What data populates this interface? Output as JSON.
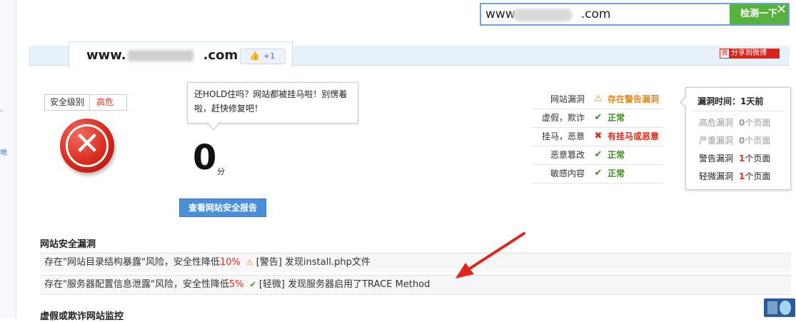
{
  "search": {
    "value_prefix": "www",
    "value_suffix": ".com",
    "button_label": "检测一下",
    "close": "✕"
  },
  "tab": {
    "domain_prefix": "www.",
    "domain_suffix": ".com",
    "like_count": "+1",
    "share_weibo": "分享到微博"
  },
  "security": {
    "level_label": "安全级别",
    "level_value": "高危",
    "score": "0",
    "score_unit": "分",
    "report_button": "查看网站安全报告"
  },
  "bubble": {
    "text": "还HOLD住吗？网站都被挂马啦！别愣着啦，赶快修复吧！"
  },
  "status": [
    {
      "key": "网站漏洞",
      "icon": "warning-icon",
      "value": "存在警告漏洞",
      "tone": "warn"
    },
    {
      "key": "虚假，欺诈",
      "icon": "check-icon",
      "value": "正常",
      "tone": "ok"
    },
    {
      "key": "挂马，恶意",
      "icon": "cross-icon",
      "value": "有挂马或恶意",
      "tone": "bad"
    },
    {
      "key": "恶意篡改",
      "icon": "check-icon",
      "value": "正常",
      "tone": "ok"
    },
    {
      "key": "敏感内容",
      "icon": "check-icon",
      "value": "正常",
      "tone": "ok"
    }
  ],
  "vuln_panel": {
    "head": "漏洞时间：1天前",
    "rows": [
      {
        "label": "高危漏洞",
        "count": "0",
        "unit": "个页面",
        "active": false
      },
      {
        "label": "严重漏洞",
        "count": "0",
        "unit": "个页面",
        "active": false
      },
      {
        "label": "警告漏洞",
        "count": "1",
        "unit": "个页面",
        "active": true
      },
      {
        "label": "轻微漏洞",
        "count": "1",
        "unit": "个页面",
        "active": true
      }
    ]
  },
  "vulns": {
    "title": "网站安全漏洞",
    "items": [
      {
        "pre": "存在\"网站目录结构暴露\"风险，安全性降低",
        "pct": "10%",
        "level": "[警告]",
        "desc": "发现install.php文件",
        "icon": "warning-icon"
      },
      {
        "pre": "存在\"服务器配置信息泄露\"风险，安全性降低",
        "pct": "5%",
        "level": "[轻微]",
        "desc": "发现服务器启用了TRACE Method",
        "icon": "check-icon"
      }
    ]
  },
  "next_section_title": "虚假或欺诈网站监控",
  "colors": {
    "danger": "#e02b1c",
    "ok": "#3b8e1e",
    "warn": "#e58a1a",
    "accent": "#4a8fd8",
    "search_button": "#56b23d"
  }
}
